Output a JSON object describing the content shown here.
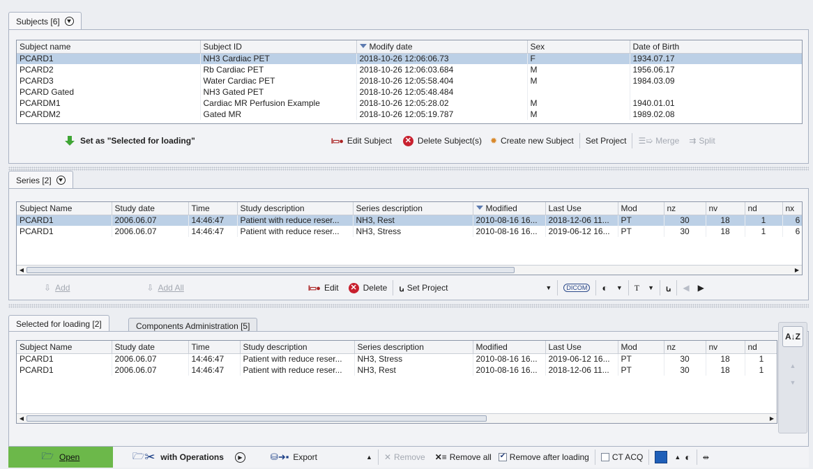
{
  "subjects": {
    "tab_label": "Subjects [6]",
    "columns": [
      "Subject name",
      "Subject ID",
      "Modify date",
      "Sex",
      "Date of Birth"
    ],
    "rows": [
      [
        "PCARD1",
        "NH3 Cardiac PET",
        "2018-10-26 12:06:06.73",
        "F",
        "1934.07.17"
      ],
      [
        "PCARD2",
        "Rb Cardiac PET",
        "2018-10-26 12:06:03.684",
        "M",
        "1956.06.17"
      ],
      [
        "PCARD3",
        "Water Cardiac PET",
        "2018-10-26 12:05:58.404",
        "M",
        "1984.03.09"
      ],
      [
        "PCARD Gated",
        "NH3 Gated PET",
        "2018-10-26 12:05:48.484",
        "",
        ""
      ],
      [
        "PCARDM1",
        "Cardiac MR Perfusion Example",
        "2018-10-26 12:05:28.02",
        "M",
        "1940.01.01"
      ],
      [
        "PCARDM2",
        "Gated MR",
        "2018-10-26 12:05:19.787",
        "M",
        "1989.02.08"
      ]
    ],
    "toolbar": {
      "set_selected": "Set as \"Selected for loading\"",
      "edit": "Edit Subject",
      "delete": "Delete Subject(s)",
      "create": "Create new Subject",
      "set_project": "Set Project",
      "merge": "Merge",
      "split": "Split"
    }
  },
  "series": {
    "tab_label": "Series [2]",
    "columns": [
      "Subject Name",
      "Study date",
      "Time",
      "Study description",
      "Series description",
      "Modified",
      "Last Use",
      "Mod",
      "nz",
      "nv",
      "nd",
      "nx"
    ],
    "rows": [
      [
        "PCARD1",
        "2006.06.07",
        "14:46:47",
        "Patient with reduce reser...",
        "NH3, Rest",
        "2010-08-16 16...",
        "2018-12-06 11...",
        "PT",
        "30",
        "18",
        "1",
        "6"
      ],
      [
        "PCARD1",
        "2006.06.07",
        "14:46:47",
        "Patient with reduce reser...",
        "NH3, Stress",
        "2010-08-16 16...",
        "2019-06-12 16...",
        "PT",
        "30",
        "18",
        "1",
        "6"
      ]
    ],
    "toolbar": {
      "add": "Add",
      "add_all": "Add All",
      "edit": "Edit",
      "delete": "Delete",
      "set_project": "Set Project",
      "dicom": "DICOM",
      "t": "T"
    }
  },
  "loading": {
    "tab_selected": "Selected for loading [2]",
    "tab_components": "Components Administration [5]",
    "columns": [
      "Subject Name",
      "Study date",
      "Time",
      "Study description",
      "Series description",
      "Modified",
      "Last Use",
      "Mod",
      "nz",
      "nv",
      "nd"
    ],
    "rows": [
      [
        "PCARD1",
        "2006.06.07",
        "14:46:47",
        "Patient with reduce reser...",
        "NH3, Stress",
        "2010-08-16 16...",
        "2019-06-12 16...",
        "PT",
        "30",
        "18",
        "1"
      ],
      [
        "PCARD1",
        "2006.06.07",
        "14:46:47",
        "Patient with reduce reser...",
        "NH3, Rest",
        "2010-08-16 16...",
        "2018-12-06 11...",
        "PT",
        "30",
        "18",
        "1"
      ]
    ],
    "sort_label": "A↓Z"
  },
  "bottom": {
    "open": "Open",
    "with_operations": "with Operations",
    "export": "Export",
    "remove": "Remove",
    "remove_all": "Remove all",
    "remove_after_loading": "Remove after loading",
    "remove_after_loading_checked": true,
    "ct_acq": "CT ACQ",
    "ct_acq_checked": false
  },
  "colors": {
    "selection": "#bcd0e6",
    "open_button": "#6cb84a",
    "delete_red": "#c8202e",
    "accent_green": "#3fa535"
  }
}
